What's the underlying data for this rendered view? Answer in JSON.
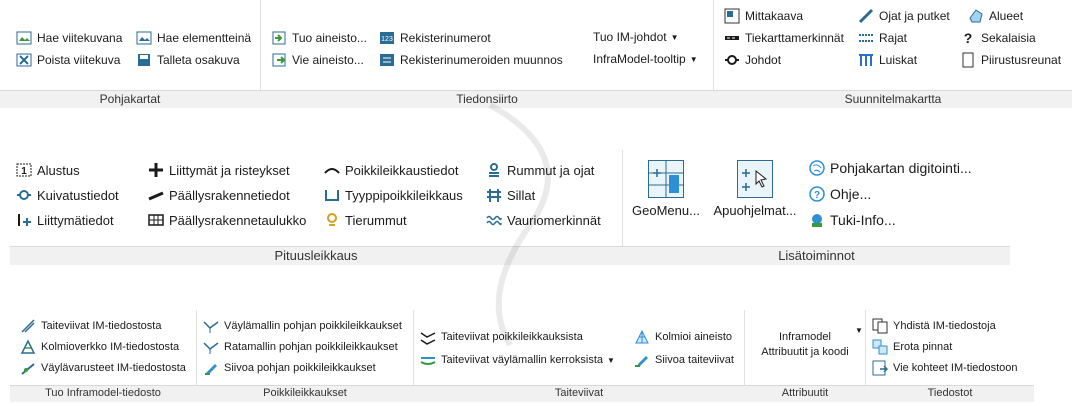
{
  "ribbon1": {
    "groups": [
      {
        "name": "Pohjakartat",
        "items": [
          {
            "label": "Hae viitekuvana",
            "icon": "map-import-icon"
          },
          {
            "label": "Hae elementteinä",
            "icon": "map-elements-icon"
          },
          {
            "label": "Poista viitekuva",
            "icon": "delete-map-icon"
          },
          {
            "label": "Talleta osakuva",
            "icon": "save-icon"
          }
        ]
      },
      {
        "name": "Tiedonsiirto",
        "items": [
          {
            "label": "Tuo aineisto...",
            "icon": "import-icon"
          },
          {
            "label": "Rekisterinumerot",
            "icon": "register-icon"
          },
          {
            "label": "Vie aineisto...",
            "icon": "export-icon"
          },
          {
            "label": "Rekisterinumeroiden  muunnos",
            "icon": "register-convert-icon"
          },
          {
            "label": "Tuo IM-johdot",
            "icon": "dropdown-icon"
          },
          {
            "label": "InfraModel-tooltip",
            "icon": "dropdown-icon"
          }
        ]
      },
      {
        "name": "Suunnitelmakartta",
        "items": [
          {
            "label": "Mittakaava",
            "icon": "scale-icon"
          },
          {
            "label": "Ojat ja putket",
            "icon": "pipes-icon"
          },
          {
            "label": "Alueet",
            "icon": "areas-icon"
          },
          {
            "label": "Tiekarttamerkinnät",
            "icon": "road-markings-icon"
          },
          {
            "label": "Rajat",
            "icon": "borders-icon"
          },
          {
            "label": "Sekalaisia",
            "icon": "misc-icon"
          },
          {
            "label": "Johdot",
            "icon": "cables-icon"
          },
          {
            "label": "Luiskat",
            "icon": "slopes-icon"
          },
          {
            "label": "Piirustusreunat",
            "icon": "drawing-frame-icon"
          }
        ]
      }
    ]
  },
  "ribbon2": {
    "groups": [
      {
        "name": "Pituusleikkaus",
        "items": [
          {
            "label": "Alustus",
            "icon": "init-icon"
          },
          {
            "label": "Liittymät ja risteykset",
            "icon": "plus-icon"
          },
          {
            "label": "Poikkileikkaustiedot",
            "icon": "cross-section-icon"
          },
          {
            "label": "Rummut ja ojat",
            "icon": "culvert-icon"
          },
          {
            "label": "Kuivatustiedot",
            "icon": "drainage-icon"
          },
          {
            "label": "Päällysrakennetiedot",
            "icon": "pavement-icon"
          },
          {
            "label": "Tyyppipoikkileikkaus",
            "icon": "type-section-icon"
          },
          {
            "label": "Sillat",
            "icon": "bridge-icon"
          },
          {
            "label": "Liittymätiedot",
            "icon": "junction-icon"
          },
          {
            "label": "Päällysrakennetaulukko",
            "icon": "table-icon"
          },
          {
            "label": "Tierummut",
            "icon": "road-culvert-icon"
          },
          {
            "label": "Vauriomerkinnät",
            "icon": "damage-icon"
          }
        ]
      },
      {
        "name": "Lisätoiminnot",
        "items": [
          {
            "label": "GeoMenu...",
            "icon": "geomenu-icon"
          },
          {
            "label": "Apuohjelmat...",
            "icon": "utilities-icon"
          },
          {
            "label": "Pohjakartan digitointi...",
            "icon": "digitize-icon"
          },
          {
            "label": "Ohje...",
            "icon": "help-icon"
          },
          {
            "label": "Tuki-Info...",
            "icon": "support-icon"
          }
        ]
      }
    ]
  },
  "ribbon3": {
    "groups": [
      {
        "name": "Tuo Inframodel-tiedosto",
        "items": [
          {
            "label": "Taiteviivat IM-tiedostosta",
            "icon": "breakline-icon"
          },
          {
            "label": "Kolmioverkko IM-tiedostosta",
            "icon": "tin-icon"
          },
          {
            "label": "Väylävarusteet IM-tiedostosta",
            "icon": "equipment-icon"
          }
        ]
      },
      {
        "name": "Poikkileikkaukset",
        "items": [
          {
            "label": "Väylämallin pohjan poikkileikkaukset",
            "icon": "fairway-section-icon"
          },
          {
            "label": "Ratamallin pohjan poikkileikkaukset",
            "icon": "rail-section-icon"
          },
          {
            "label": "Siivoa pohjan poikkileikkaukset",
            "icon": "clean-icon"
          }
        ]
      },
      {
        "name": "Taiteviivat",
        "items": [
          {
            "label": "Taiteviivat poikkileikkauksista",
            "icon": "breakline-section-icon"
          },
          {
            "label": "Kolmioi aineisto",
            "icon": "triangulate-icon"
          },
          {
            "label": "Taiteviivat väylämallin kerroksista",
            "icon": "breakline-layers-icon"
          },
          {
            "label": "Siivoa taiteviivat",
            "icon": "clean-breaklines-icon"
          }
        ]
      },
      {
        "name": "Attribuutit",
        "items": [
          {
            "label": "Inframodel Attribuutit ja koodi",
            "icon": "dropdown-icon"
          }
        ]
      },
      {
        "name": "Tiedostot",
        "items": [
          {
            "label": "Yhdistä IM-tiedostoja",
            "icon": "merge-icon"
          },
          {
            "label": "Erota pinnat",
            "icon": "separate-icon"
          },
          {
            "label": "Vie kohteet IM-tiedostoon",
            "icon": "export-im-icon"
          }
        ]
      }
    ]
  },
  "colors": {
    "accent": "#2b6c96",
    "green": "#3a9a3a",
    "footer": "#f1f1f1",
    "border": "#d9d9d9"
  }
}
